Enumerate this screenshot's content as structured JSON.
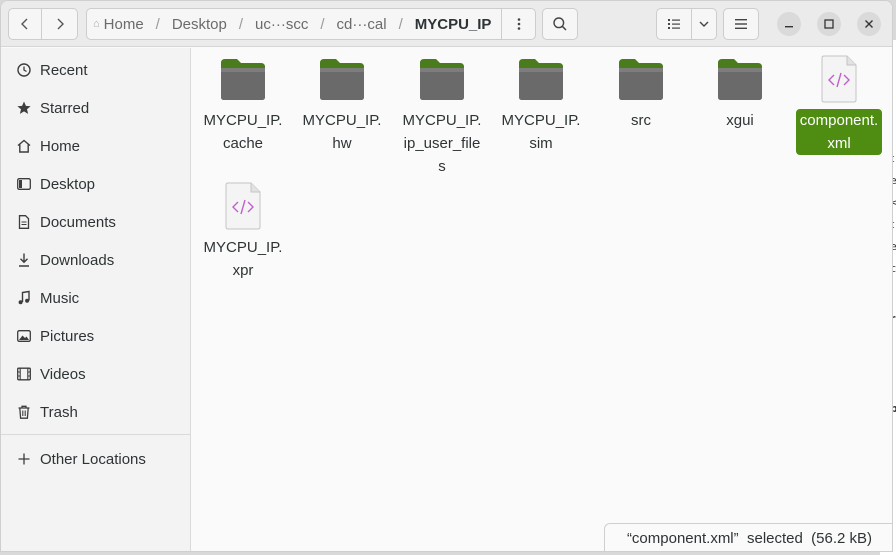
{
  "background_window": {
    "chars": [
      "t",
      "e",
      "<",
      "t",
      "e",
      "c",
      "r",
      "p"
    ]
  },
  "header": {
    "back_icon": "chevron-left-icon",
    "forward_icon": "chevron-right-icon",
    "breadcrumbs": [
      "Home",
      "Desktop",
      "uc···scc",
      "cd···cal",
      "MYCPU_IP"
    ],
    "path_menu_icon": "kebab-menu-icon",
    "search_icon": "search-icon",
    "view_icon": "list-view-icon",
    "view_dropdown_icon": "chevron-down-icon",
    "menu_icon": "hamburger-icon",
    "window_controls": [
      "minimize-icon",
      "maximize-icon",
      "close-icon"
    ]
  },
  "sidebar": {
    "items": [
      {
        "label": "Recent",
        "icon": "clock-icon"
      },
      {
        "label": "Starred",
        "icon": "star-icon"
      },
      {
        "label": "Home",
        "icon": "home-icon"
      },
      {
        "label": "Desktop",
        "icon": "desktop-icon"
      },
      {
        "label": "Documents",
        "icon": "document-icon"
      },
      {
        "label": "Downloads",
        "icon": "download-icon"
      },
      {
        "label": "Music",
        "icon": "music-icon"
      },
      {
        "label": "Pictures",
        "icon": "picture-icon"
      },
      {
        "label": "Videos",
        "icon": "video-icon"
      },
      {
        "label": "Trash",
        "icon": "trash-icon"
      }
    ],
    "other_locations": {
      "label": "Other Locations",
      "icon": "plus-icon"
    }
  },
  "files": [
    {
      "name": "MYCPU_IP.cache",
      "type": "folder"
    },
    {
      "name": "MYCPU_IP.hw",
      "type": "folder"
    },
    {
      "name": "MYCPU_IP.ip_user_files",
      "type": "folder"
    },
    {
      "name": "MYCPU_IP.sim",
      "type": "folder"
    },
    {
      "name": "src",
      "type": "folder"
    },
    {
      "name": "xgui",
      "type": "folder"
    },
    {
      "name": "component.xml",
      "type": "xml",
      "selected": true
    },
    {
      "name": "MYCPU_IP.xpr",
      "type": "xml"
    }
  ],
  "status": {
    "text": "“component.xml”  selected  (56.2 kB)"
  },
  "colors": {
    "accent": "#4e8d12",
    "folder": "#5a7a3a",
    "xml_glyph": "#c061cb"
  }
}
